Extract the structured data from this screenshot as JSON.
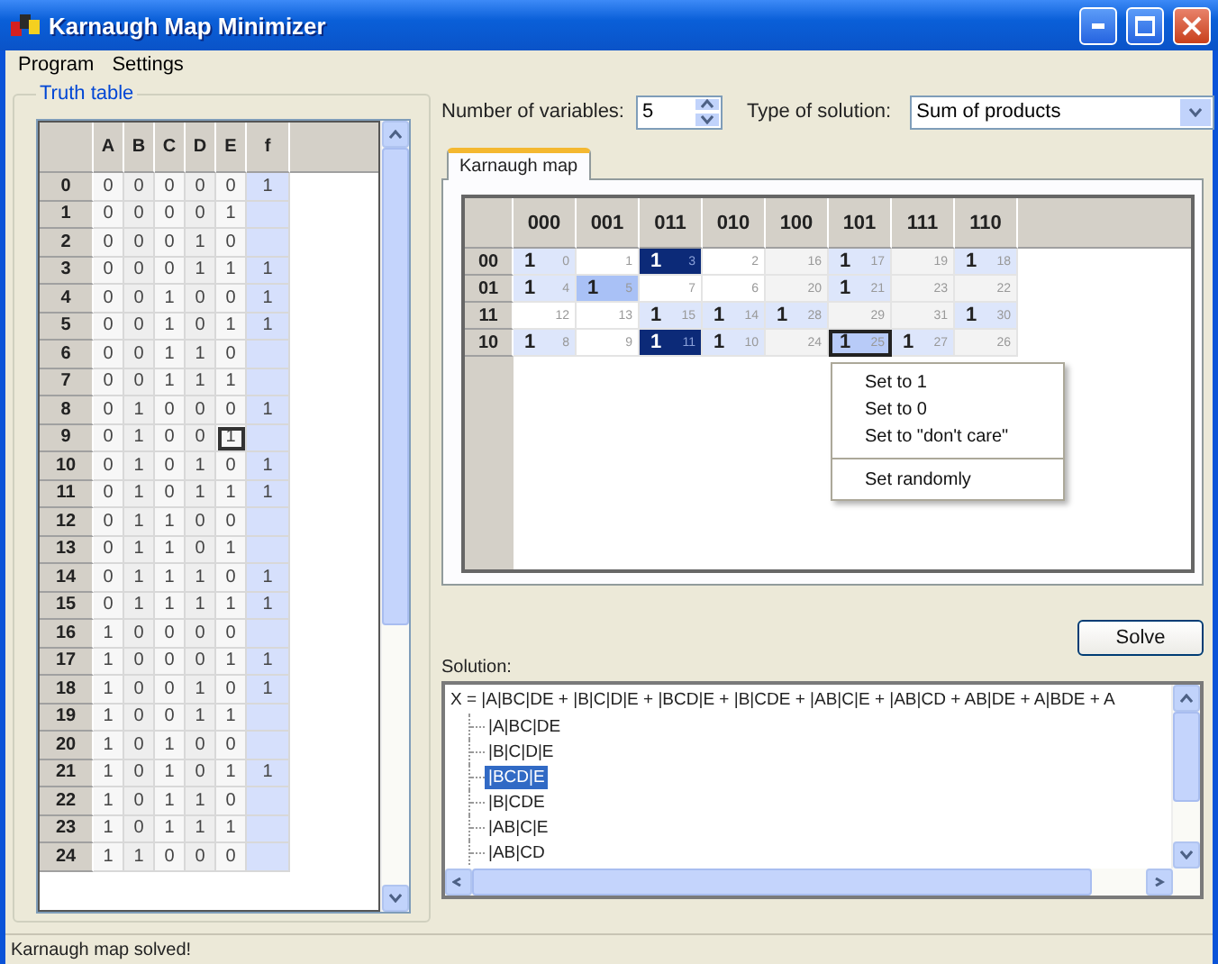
{
  "window": {
    "title": "Karnaugh Map Minimizer"
  },
  "menu": [
    "Program",
    "Settings"
  ],
  "truth_table": {
    "title": "Truth table",
    "columns": [
      "A",
      "B",
      "C",
      "D",
      "E",
      "f"
    ],
    "rows": [
      {
        "index": "0",
        "bits": [
          "0",
          "0",
          "0",
          "0",
          "0"
        ],
        "f": "1",
        "selected": false
      },
      {
        "index": "1",
        "bits": [
          "0",
          "0",
          "0",
          "0",
          "1"
        ],
        "selected": false
      },
      {
        "index": "2",
        "bits": [
          "0",
          "0",
          "0",
          "1",
          "0"
        ],
        "selected": false
      },
      {
        "index": "3",
        "bits": [
          "0",
          "0",
          "0",
          "1",
          "1"
        ],
        "f": "1",
        "selected": false
      },
      {
        "index": "4",
        "bits": [
          "0",
          "0",
          "1",
          "0",
          "0"
        ],
        "f": "1",
        "selected": false
      },
      {
        "index": "5",
        "bits": [
          "0",
          "0",
          "1",
          "0",
          "1"
        ],
        "f": "1",
        "selected": false
      },
      {
        "index": "6",
        "bits": [
          "0",
          "0",
          "1",
          "1",
          "0"
        ],
        "selected": false
      },
      {
        "index": "7",
        "bits": [
          "0",
          "0",
          "1",
          "1",
          "1"
        ],
        "selected": false
      },
      {
        "index": "8",
        "bits": [
          "0",
          "1",
          "0",
          "0",
          "0"
        ],
        "f": "1",
        "selected": false
      },
      {
        "index": "9",
        "bits": [
          "0",
          "1",
          "0",
          "0",
          "1"
        ],
        "selected": true
      },
      {
        "index": "10",
        "bits": [
          "0",
          "1",
          "0",
          "1",
          "0"
        ],
        "f": "1",
        "selected": false
      },
      {
        "index": "11",
        "bits": [
          "0",
          "1",
          "0",
          "1",
          "1"
        ],
        "f": "1",
        "selected": false
      },
      {
        "index": "12",
        "bits": [
          "0",
          "1",
          "1",
          "0",
          "0"
        ],
        "selected": false
      },
      {
        "index": "13",
        "bits": [
          "0",
          "1",
          "1",
          "0",
          "1"
        ],
        "selected": false
      },
      {
        "index": "14",
        "bits": [
          "0",
          "1",
          "1",
          "1",
          "0"
        ],
        "f": "1",
        "selected": false
      },
      {
        "index": "15",
        "bits": [
          "0",
          "1",
          "1",
          "1",
          "1"
        ],
        "f": "1",
        "selected": false
      },
      {
        "index": "16",
        "bits": [
          "1",
          "0",
          "0",
          "0",
          "0"
        ],
        "selected": false
      },
      {
        "index": "17",
        "bits": [
          "1",
          "0",
          "0",
          "0",
          "1"
        ],
        "f": "1",
        "selected": false
      },
      {
        "index": "18",
        "bits": [
          "1",
          "0",
          "0",
          "1",
          "0"
        ],
        "f": "1",
        "selected": false
      },
      {
        "index": "19",
        "bits": [
          "1",
          "0",
          "0",
          "1",
          "1"
        ],
        "selected": false
      },
      {
        "index": "20",
        "bits": [
          "1",
          "0",
          "1",
          "0",
          "0"
        ],
        "selected": false
      },
      {
        "index": "21",
        "bits": [
          "1",
          "0",
          "1",
          "0",
          "1"
        ],
        "f": "1",
        "selected": false
      },
      {
        "index": "22",
        "bits": [
          "1",
          "0",
          "1",
          "1",
          "0"
        ],
        "selected": false
      },
      {
        "index": "23",
        "bits": [
          "1",
          "0",
          "1",
          "1",
          "1"
        ],
        "selected": false
      },
      {
        "index": "24",
        "bits": [
          "1",
          "1",
          "0",
          "0",
          "0"
        ],
        "selected": false
      }
    ]
  },
  "number_of_variables": {
    "label": "Number of variables:",
    "value": "5"
  },
  "solution_type": {
    "label": "Type of solution:",
    "value": "Sum of products"
  },
  "tabs": [
    {
      "label": "Karnaugh map",
      "selected": true
    }
  ],
  "karnaugh_map": {
    "column_headers": [
      "000",
      "001",
      "011",
      "010",
      "100",
      "101",
      "111",
      "110"
    ],
    "rows": [
      {
        "header": "00",
        "cells": [
          {
            "value": "1",
            "index": "0",
            "kind": "light"
          },
          {
            "index": "1",
            "kind": "white"
          },
          {
            "value": "1",
            "index": "3",
            "kind": "dark"
          },
          {
            "index": "2",
            "kind": "white"
          },
          {
            "index": "16",
            "kind": "grey"
          },
          {
            "value": "1",
            "index": "17",
            "kind": "light"
          },
          {
            "index": "19",
            "kind": "grey"
          },
          {
            "value": "1",
            "index": "18",
            "kind": "light"
          }
        ]
      },
      {
        "header": "01",
        "cells": [
          {
            "value": "1",
            "index": "4",
            "kind": "light"
          },
          {
            "value": "1",
            "index": "5",
            "kind": "mid"
          },
          {
            "index": "7",
            "kind": "white"
          },
          {
            "index": "6",
            "kind": "white"
          },
          {
            "index": "20",
            "kind": "grey"
          },
          {
            "value": "1",
            "index": "21",
            "kind": "light"
          },
          {
            "index": "23",
            "kind": "grey"
          },
          {
            "index": "22",
            "kind": "grey"
          }
        ]
      },
      {
        "header": "11",
        "cells": [
          {
            "index": "12",
            "kind": "white"
          },
          {
            "index": "13",
            "kind": "white"
          },
          {
            "value": "1",
            "index": "15",
            "kind": "light"
          },
          {
            "value": "1",
            "index": "14",
            "kind": "light"
          },
          {
            "value": "1",
            "index": "28",
            "kind": "light"
          },
          {
            "index": "29",
            "kind": "grey"
          },
          {
            "index": "31",
            "kind": "grey"
          },
          {
            "value": "1",
            "index": "30",
            "kind": "light"
          }
        ]
      },
      {
        "header": "10",
        "cells": [
          {
            "value": "1",
            "index": "8",
            "kind": "light"
          },
          {
            "index": "9",
            "kind": "white"
          },
          {
            "value": "1",
            "index": "11",
            "kind": "dark"
          },
          {
            "value": "1",
            "index": "10",
            "kind": "light"
          },
          {
            "index": "24",
            "kind": "grey"
          },
          {
            "value": "1",
            "index": "25",
            "kind": "selected"
          },
          {
            "value": "1",
            "index": "27",
            "kind": "light"
          },
          {
            "index": "26",
            "kind": "grey"
          }
        ]
      }
    ]
  },
  "context_menu": [
    {
      "label": "Set to 1",
      "separator_before": false
    },
    {
      "label": "Set to 0",
      "separator_before": false
    },
    {
      "label": "Set to \"don't care\"",
      "separator_before": false
    },
    {
      "label": "Set randomly",
      "separator_before": true
    }
  ],
  "solve_button": "Solve",
  "solution": {
    "label": "Solution:",
    "expression": "X = |A|BC|DE + |B|C|D|E + |BCD|E + |B|CDE + |AB|C|E + |AB|CD + AB|DE + A|BDE + A",
    "terms": [
      {
        "text": "|A|BC|DE",
        "selected": false
      },
      {
        "text": "|B|C|D|E",
        "selected": false
      },
      {
        "text": "|BCD|E",
        "selected": true
      },
      {
        "text": "|B|CDE",
        "selected": false
      },
      {
        "text": "|AB|C|E",
        "selected": false
      },
      {
        "text": "|AB|CD",
        "selected": false
      }
    ]
  },
  "status_bar": "Karnaugh map solved!"
}
